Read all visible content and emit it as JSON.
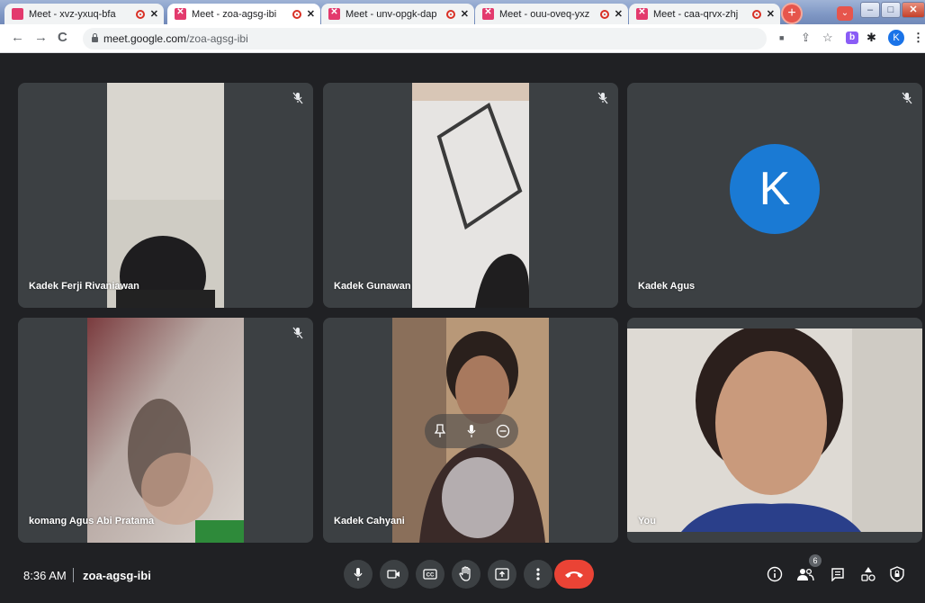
{
  "browser": {
    "tabs": [
      {
        "title": "Meet - xvz-yxuq-bfa",
        "active": false
      },
      {
        "title": "Meet - zoa-agsg-ibi",
        "active": true
      },
      {
        "title": "Meet - unv-opgk-dap",
        "active": false
      },
      {
        "title": "Meet - ouu-oveq-yxz",
        "active": false
      },
      {
        "title": "Meet - caa-qrvx-zhj",
        "active": false
      }
    ],
    "tab_close_glyph": "✕",
    "new_tab_glyph": "+",
    "tab_search_glyph": "⌄",
    "window": {
      "minimize": "–",
      "maximize": "□",
      "close": "✕"
    },
    "nav": {
      "back": "←",
      "forward": "→",
      "reload": "C"
    },
    "url_host": "meet.google.com",
    "url_path": "/zoa-agsg-ibi",
    "toolbar_icons": {
      "camera": "■",
      "share": "⇪",
      "bookmark": "☆",
      "extension_b": "b",
      "extensions": "✱",
      "profile": "K",
      "menu": "⋮"
    }
  },
  "meeting": {
    "participants": [
      {
        "name": "Kadek Ferji Rivaniawan",
        "muted": true,
        "video": true
      },
      {
        "name": "Kadek Gunawan",
        "muted": true,
        "video": true
      },
      {
        "name": "Kadek Agus",
        "muted": true,
        "video": false,
        "avatar_letter": "K"
      },
      {
        "name": "komang Agus Abi Pratama",
        "muted": true,
        "video": true
      },
      {
        "name": "Kadek Cahyani",
        "muted": false,
        "video": true
      },
      {
        "name": "You",
        "muted": false,
        "video": true
      }
    ],
    "time": "8:36 AM",
    "code": "zoa-agsg-ibi",
    "participant_count": "6"
  },
  "colors": {
    "accent_red": "#ea4335",
    "avatar_blue": "#1a7ad4",
    "tile_bg": "#3c4043",
    "page_bg": "#202124"
  }
}
